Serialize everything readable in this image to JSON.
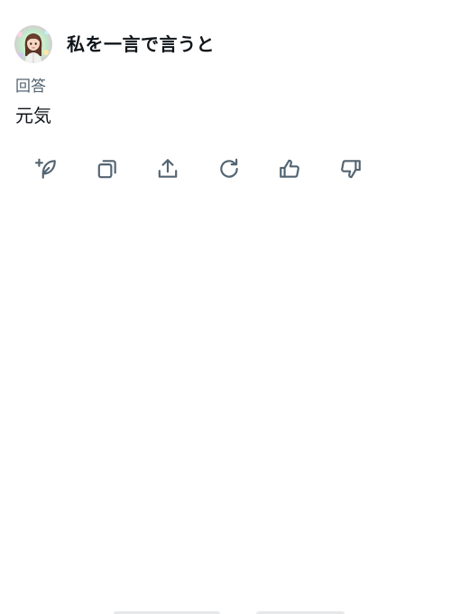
{
  "header": {
    "title": "私を一言で言うと"
  },
  "answer": {
    "label": "回答",
    "text": "元気"
  },
  "actions": [
    {
      "icon": "sparkle-feather-icon"
    },
    {
      "icon": "copy-icon"
    },
    {
      "icon": "share-icon"
    },
    {
      "icon": "regenerate-icon"
    },
    {
      "icon": "thumbs-up-icon"
    },
    {
      "icon": "thumbs-down-icon"
    }
  ],
  "colors": {
    "text": "#0f1419",
    "secondary": "#536471"
  }
}
